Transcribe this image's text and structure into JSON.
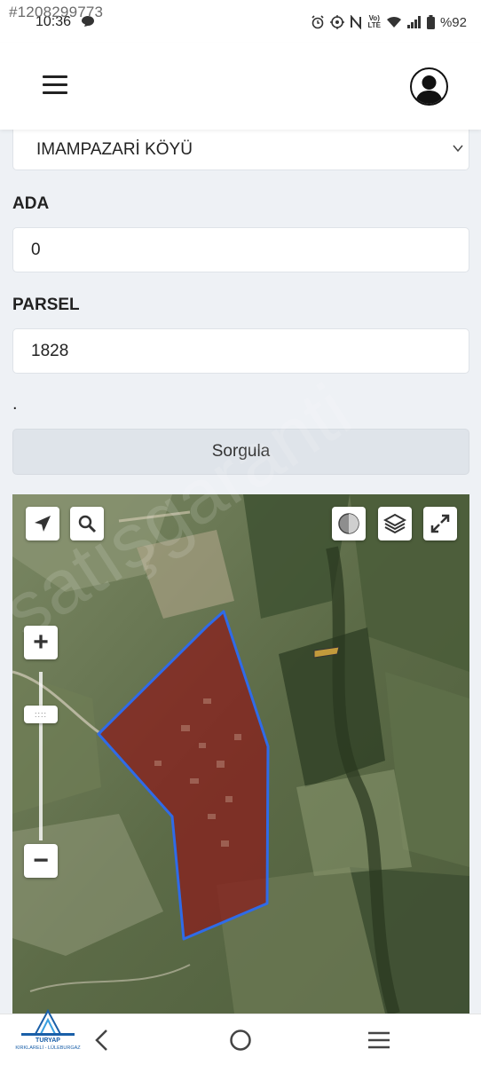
{
  "status_bar": {
    "listing_id": "#1208299773",
    "time": "10:36",
    "battery": "%92",
    "icons": [
      "chat-bubble-icon",
      "alarm-icon",
      "target-icon",
      "nfc-icon",
      "volte-icon",
      "wifi-icon",
      "signal-icon",
      "battery-icon"
    ],
    "volte_line1": "Vo)",
    "volte_line2": "LTE"
  },
  "header": {
    "menu_icon": "hamburger-menu-icon",
    "profile_icon": "user-avatar-icon"
  },
  "form": {
    "village_select": {
      "value": "IMAMPAZARİ KÖYÜ"
    },
    "ada": {
      "label": "ADA",
      "value": "0"
    },
    "parsel": {
      "label": "PARSEL",
      "value": "1828"
    },
    "dot": ".",
    "query_button": "Sorgula"
  },
  "map": {
    "controls_left": [
      "locate-arrow-icon",
      "search-icon"
    ],
    "controls_right": [
      "basemap-toggle-icon",
      "layers-icon",
      "fullscreen-icon"
    ],
    "zoom_in": "+",
    "zoom_out": "−",
    "zoom_handle": "::::",
    "parcel_fill": "#8b1a1a",
    "parcel_stroke": "#2f6be8",
    "watermark": "satışgaranti"
  },
  "footer": {
    "logo_name": "TURYAP",
    "logo_sub": "KIRKLARELİ - LÜLEBURGAZ",
    "nav": [
      "back-icon",
      "home-icon",
      "recent-apps-icon"
    ]
  },
  "colors": {
    "background": "#eef1f5",
    "button": "#dfe4ea",
    "parcel": "#8b1a1a",
    "parcel_border": "#2f6be8"
  }
}
